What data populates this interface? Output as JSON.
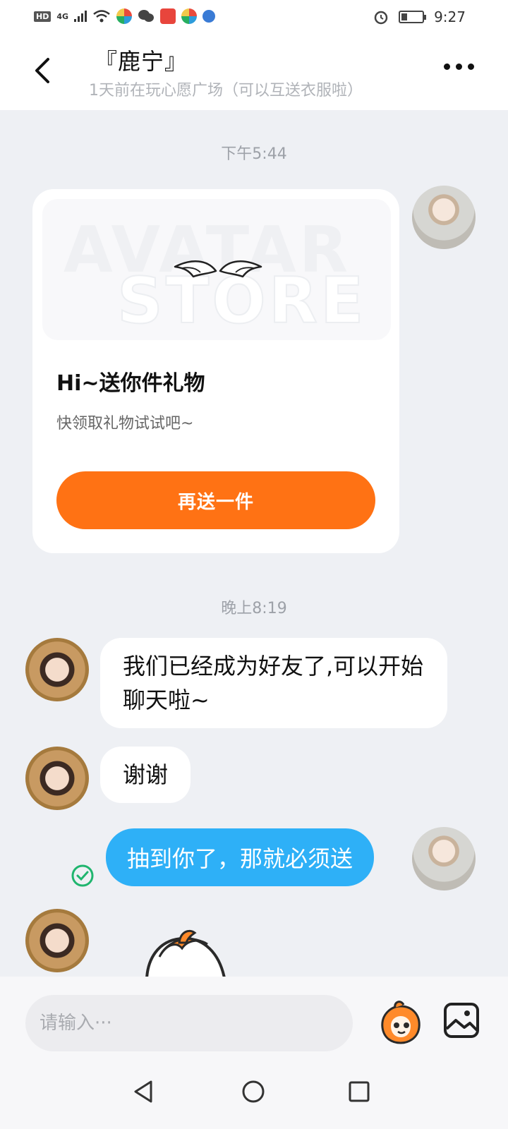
{
  "status_bar": {
    "hd_label": "HD",
    "network": "4G",
    "time": "9:27"
  },
  "header": {
    "title": "『鹿宁』",
    "subtitle": "1天前在玩心愿广场（可以互送衣服啦）"
  },
  "messages": {
    "time_1": "下午5:44",
    "gift_card": {
      "banner_text_1": "AVATAR",
      "banner_text_2": "STORE",
      "title": "Hi~送你件礼物",
      "description": "快领取礼物试试吧~",
      "button_label": "再送一件"
    },
    "time_2": "晚上8:19",
    "friend_msg_1": "我们已经成为好友了,可以开始聊天啦~",
    "friend_msg_2": "谢谢",
    "self_msg_1": "抽到你了，那就必须送"
  },
  "input_bar": {
    "placeholder": "请输入···"
  },
  "colors": {
    "accent_orange": "#ff7214",
    "bubble_blue": "#2eb0f7",
    "read_green": "#1fb56e",
    "background": "#eef0f4"
  }
}
